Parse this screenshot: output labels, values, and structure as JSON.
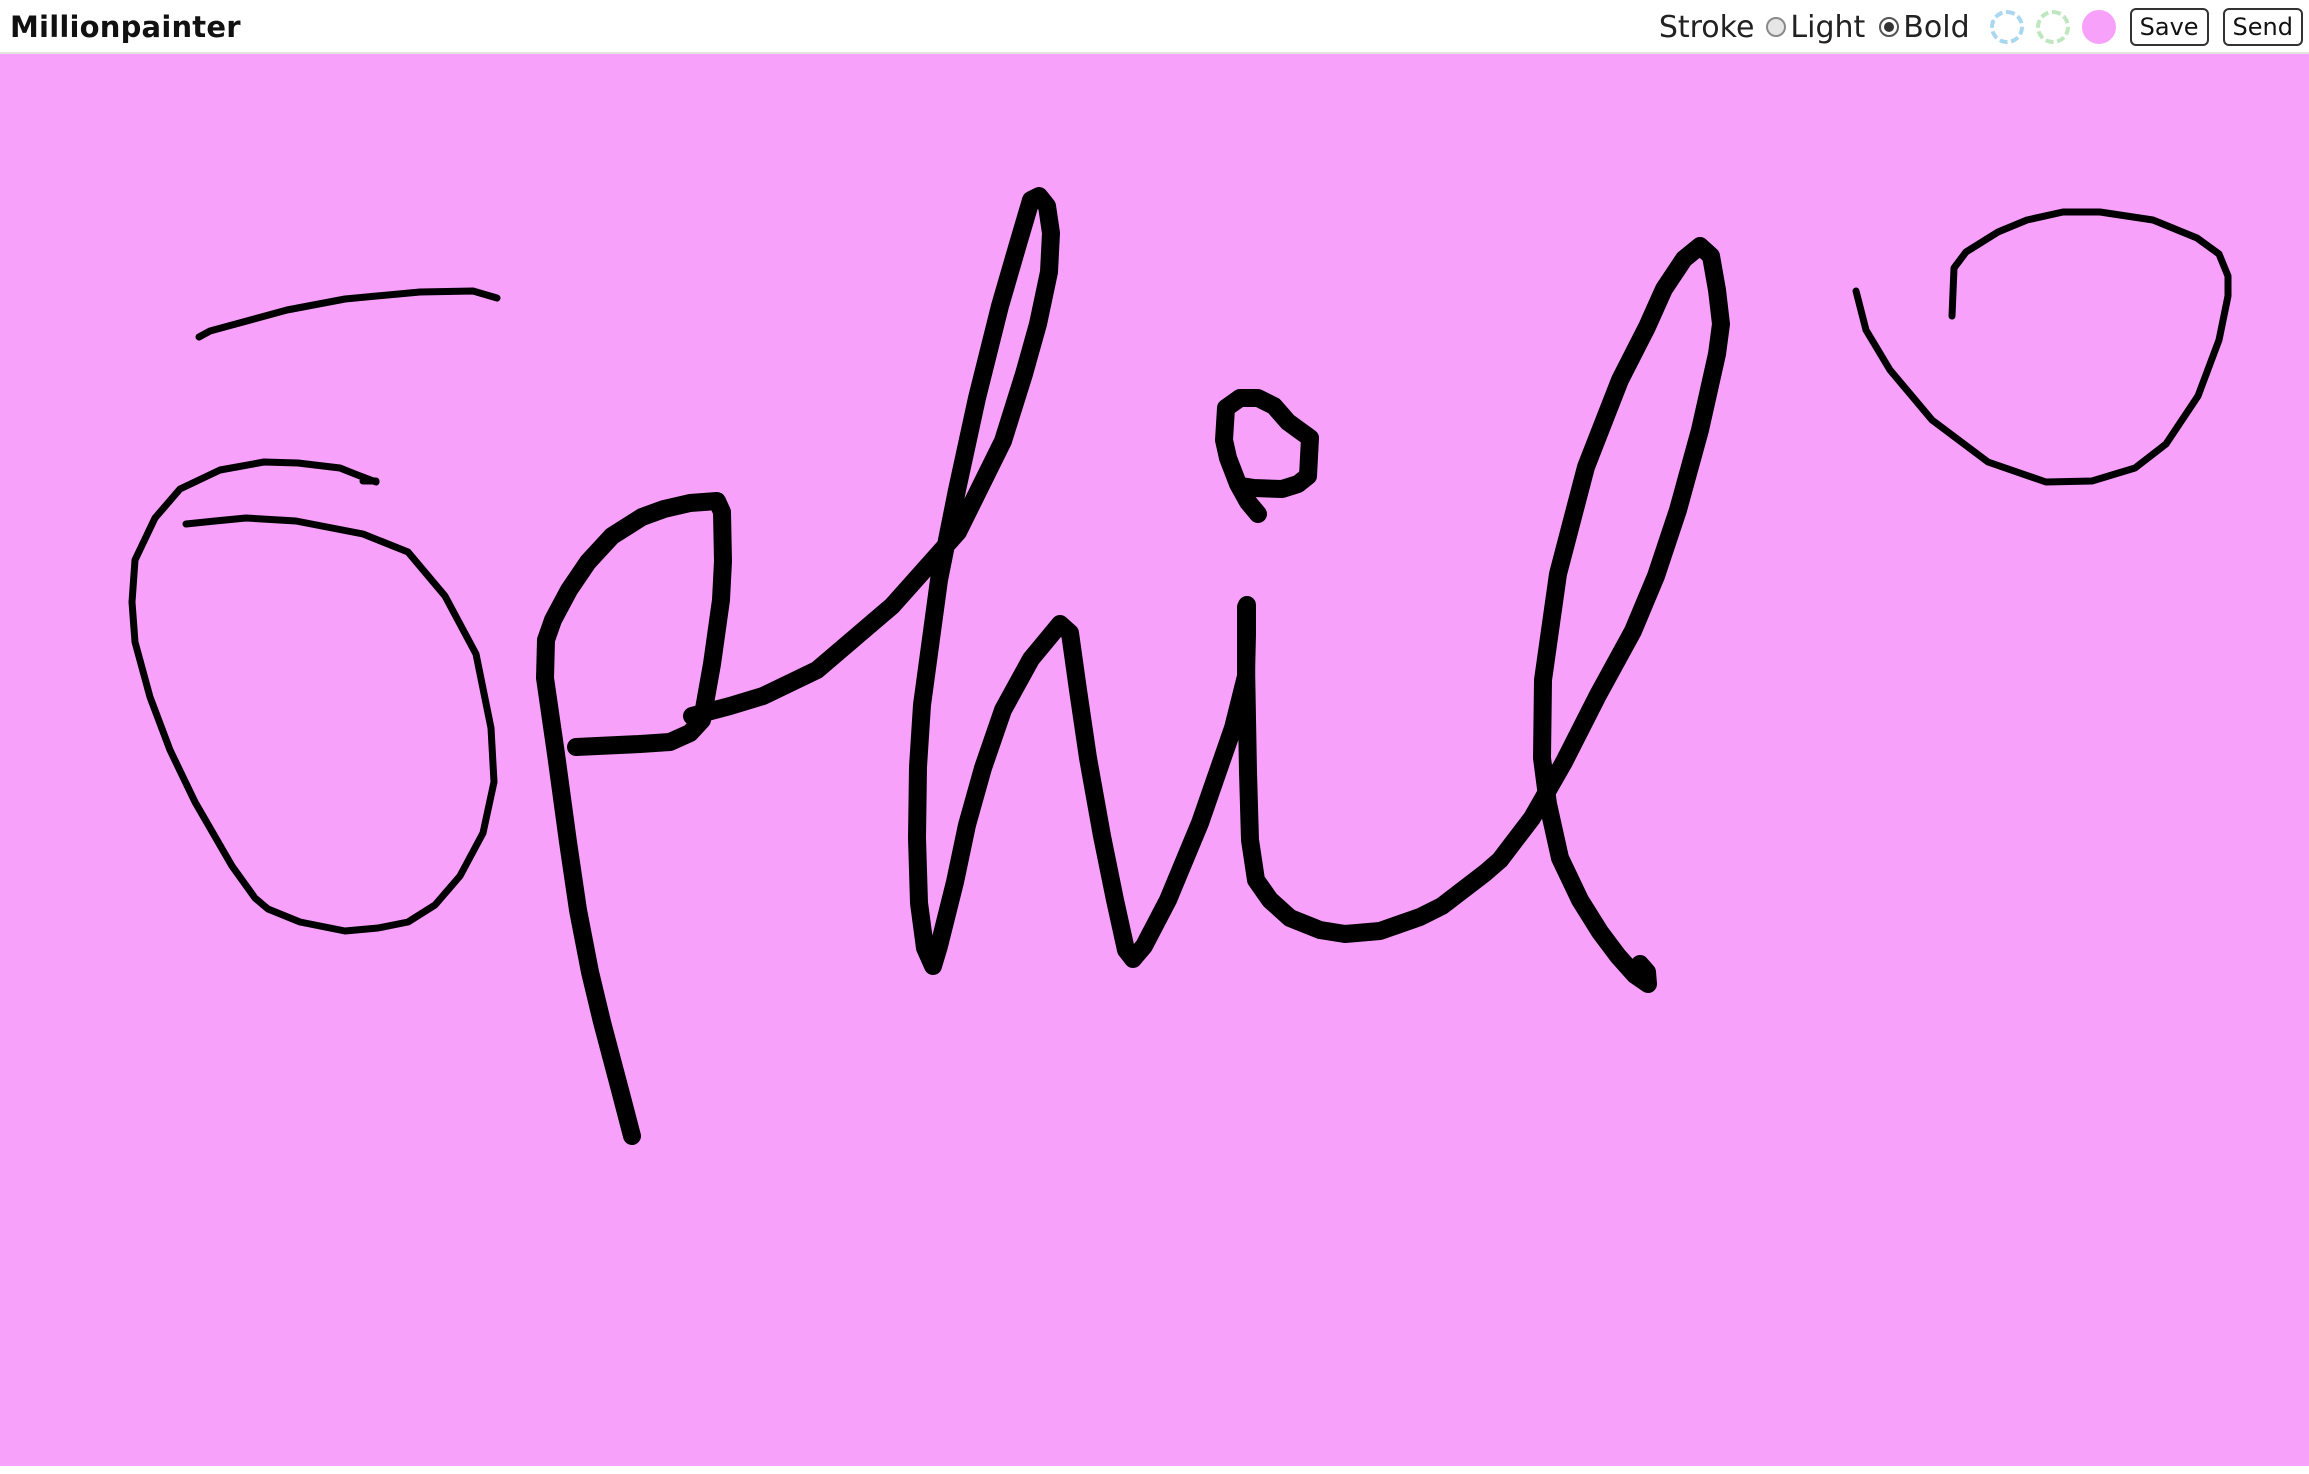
{
  "app": {
    "title": "Millionpainter"
  },
  "toolbar": {
    "stroke_label": "Stroke",
    "light_label": "Light",
    "bold_label": "Bold",
    "selected_stroke": "Bold",
    "save_label": "Save",
    "send_label": "Send",
    "swatches": [
      {
        "name": "light-blue",
        "color": "#a9d7ef",
        "style": "dashed"
      },
      {
        "name": "light-green",
        "color": "#bfe7bf",
        "style": "dashed"
      },
      {
        "name": "pink",
        "color": "#f7a1fb",
        "style": "solid"
      }
    ]
  },
  "canvas": {
    "background_color": "#f7a1fb",
    "ink_color": "#000000"
  }
}
